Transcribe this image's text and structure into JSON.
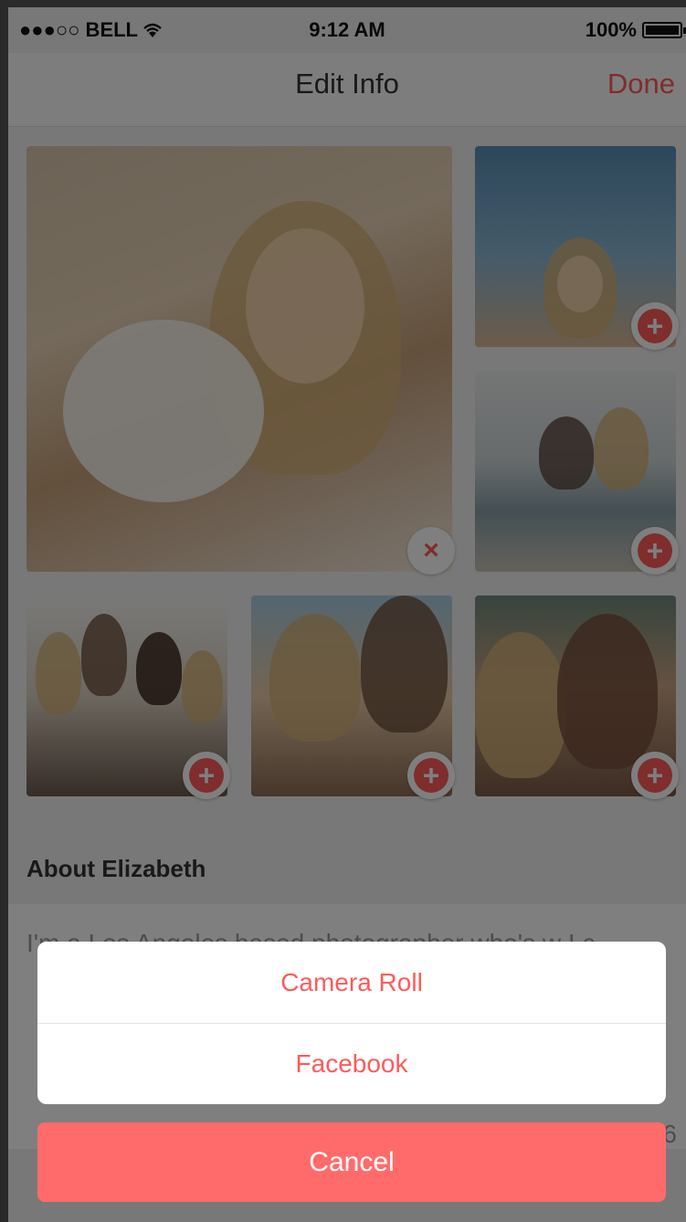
{
  "status_bar": {
    "carrier": "●●●○○ BELL",
    "time": "9:12 AM",
    "battery": "100%"
  },
  "nav": {
    "title": "Edit Info",
    "done_label": "Done"
  },
  "photos": {
    "remove_icon": "×",
    "add_icon": "+"
  },
  "about": {
    "label": "About Elizabeth",
    "text": "I'm a Los Angeles based photographer who's w I c",
    "char_count": "6"
  },
  "action_sheet": {
    "options": [
      "Camera Roll",
      "Facebook"
    ],
    "cancel_label": "Cancel"
  },
  "colors": {
    "accent": "#ff5a5a",
    "cancel_bg": "#ff6b6b"
  }
}
